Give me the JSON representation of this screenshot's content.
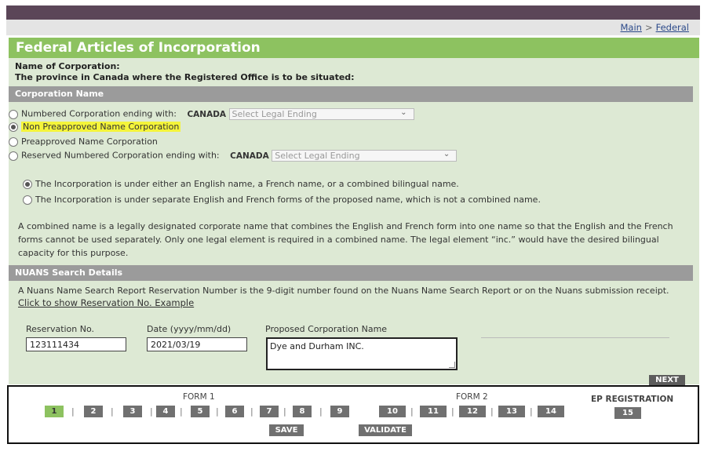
{
  "breadcrumb": {
    "main": "Main",
    "separator": ">",
    "federal": "Federal"
  },
  "page_title": "Federal Articles of Incorporation",
  "intro": {
    "name_of_corporation": "Name of Corporation:",
    "province_line": "The province in Canada where the Registered Office is to be situated:"
  },
  "corporation_name": {
    "section_title": "Corporation Name",
    "options": [
      {
        "label": "Numbered Corporation ending with:",
        "selected": false,
        "prefix": "CANADA",
        "select_placeholder": "Select Legal Ending"
      },
      {
        "label": "Non Preapproved Name Corporation",
        "selected": true
      },
      {
        "label": "Preapproved Name Corporation",
        "selected": false
      },
      {
        "label": "Reserved Numbered Corporation ending with:",
        "selected": false,
        "prefix": "CANADA",
        "select_placeholder": "Select Legal Ending"
      }
    ],
    "name_form_options": [
      {
        "label": "The Incorporation is under either an English name, a French name, or a combined bilingual name.",
        "selected": true
      },
      {
        "label": "The Incorporation is under separate English and French forms of the proposed name, which is not a combined name.",
        "selected": false
      }
    ],
    "combined_name_info": "A combined name is a legally designated corporate name that combines the English and French form into one name so that the English and the French forms cannot be used separately. Only one legal element is required in a combined name. The legal element “inc.” would have the desired bilingual capacity for this purpose."
  },
  "nuans": {
    "section_title": "NUANS Search Details",
    "info": "A Nuans Name Search Report Reservation Number is the 9-digit number found on the Nuans Name Search Report or on the Nuans submission receipt.",
    "link": "Click to show Reservation No. Example",
    "reservation_label": "Reservation No.",
    "reservation_value": "123111434",
    "date_label": "Date (yyyy/mm/dd)",
    "date_value": "2021/03/19",
    "proposed_label": "Proposed Corporation Name",
    "proposed_value": "Dye and Durham INC."
  },
  "next_label": "NEXT",
  "footer": {
    "form1_label": "FORM 1",
    "form2_label": "FORM 2",
    "ep_label": "EP REGISTRATION",
    "pages": [
      "1",
      "2",
      "3",
      "4",
      "5",
      "6",
      "7",
      "8",
      "9",
      "10",
      "11",
      "12",
      "13",
      "14",
      "15"
    ],
    "active_page": "1",
    "save_label": "SAVE",
    "validate_label": "VALIDATE"
  },
  "colors": {
    "accent_green": "#8dc260",
    "top_bar": "#5b4658",
    "section_gray": "#9b9b9b",
    "highlight": "#f4f43a"
  }
}
